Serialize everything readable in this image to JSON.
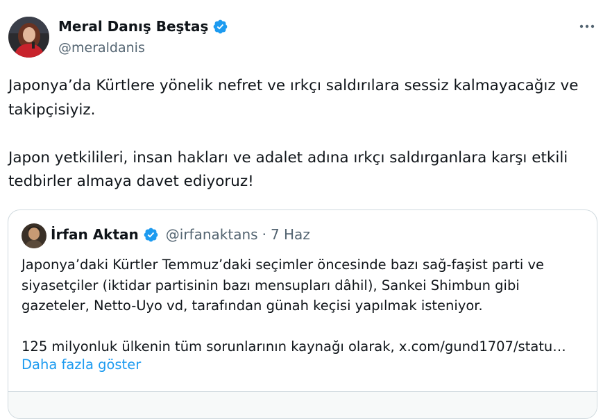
{
  "author": {
    "name": "Meral Danış Beştaş",
    "handle": "@meraldanis",
    "verified_icon": "verified-badge-icon"
  },
  "post": {
    "paragraphs": [
      "Japonya’da Kürtlere yönelik nefret ve ırkçı saldırılara sessiz kalmayacağız ve takipçisiyiz.",
      "Japon yetkilileri, insan hakları ve adalet adına ırkçı saldırganlara karşı etkili tedbirler almaya davet ediyoruz!"
    ]
  },
  "quote": {
    "name": "İrfan Aktan",
    "handle": "@irfanaktans",
    "separator": "·",
    "date": "7 Haz",
    "paragraphs": [
      "Japonya’daki Kürtler Temmuz’daki seçimler öncesinde bazı sağ-faşist parti ve siyasetçiler (iktidar partisinin bazı mensupları dâhil), Sankei Shimbun gibi gazeteler, Netto-Uyo vd, tarafından günah keçisi yapılmak isteniyor.",
      "125 milyonluk ülkenin tüm sorunlarının kaynağı olarak, x.com/gund1707/statu…"
    ],
    "show_more": "Daha fazla göster"
  },
  "icons": {
    "more": "more-horizontal-icon",
    "verified": "verified-badge-icon"
  },
  "colors": {
    "text": "#0f1419",
    "secondary": "#536471",
    "link": "#1d9bf0",
    "verified": "#1d9bf0",
    "border": "#cfd9de"
  }
}
